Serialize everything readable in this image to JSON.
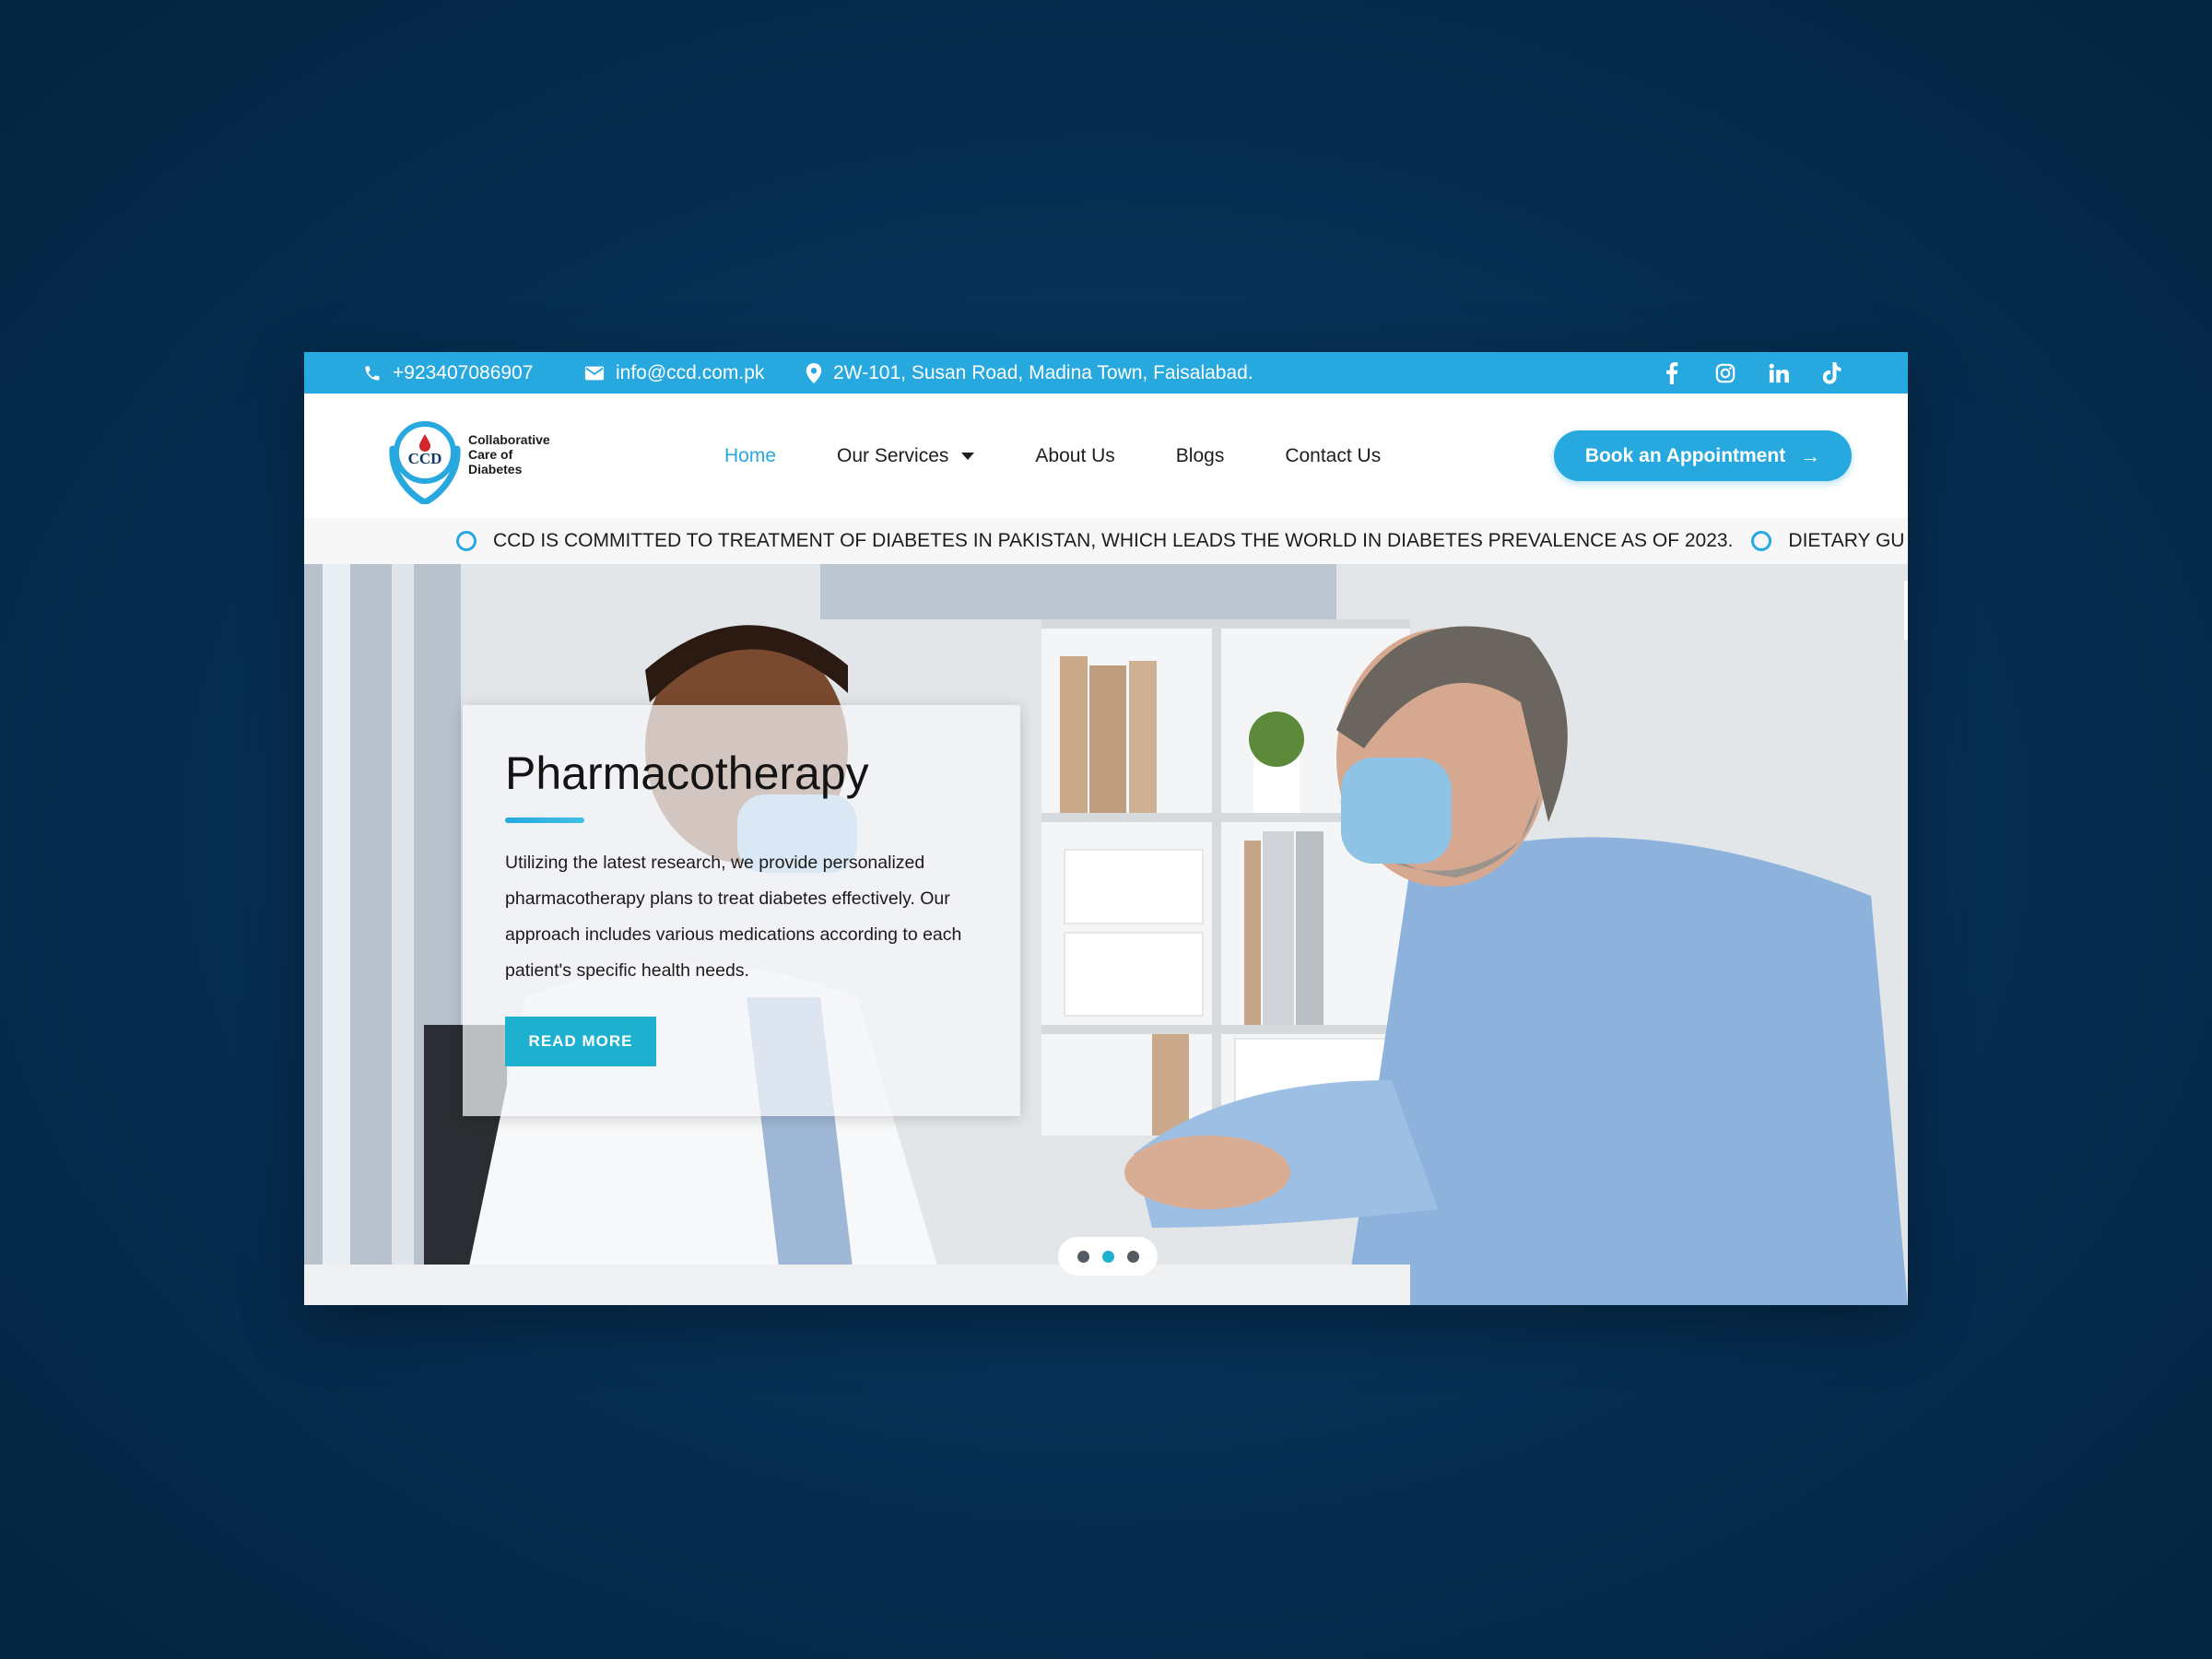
{
  "topbar": {
    "phone": "+923407086907",
    "email": "info@ccd.com.pk",
    "address": "2W-101, Susan Road, Madina Town, Faisalabad.",
    "icons": [
      "phone-icon",
      "mail-icon",
      "location-pin-icon"
    ],
    "social": [
      "facebook-icon",
      "instagram-icon",
      "linkedin-icon",
      "tiktok-icon"
    ],
    "bg_color": "#27a8df"
  },
  "logo": {
    "mark": "CCD",
    "line1": "Collaborative",
    "line2": "Care of",
    "line3": "Diabetes"
  },
  "nav": {
    "items": [
      {
        "label": "Home",
        "active": true
      },
      {
        "label": "Our Services",
        "has_dropdown": true
      },
      {
        "label": "About Us"
      },
      {
        "label": "Blogs"
      },
      {
        "label": "Contact Us"
      }
    ],
    "active_color": "#27a8df"
  },
  "cta": {
    "label": "Book an Appointment",
    "icon": "arrow-right-icon"
  },
  "ticker": {
    "items": [
      "CCD IS COMMITTED TO TREATMENT OF DIABETES IN PAKISTAN, WHICH LEADS THE WORLD IN DIABETES PREVALENCE AS OF 2023.",
      "DIETARY GU"
    ]
  },
  "hero": {
    "title": "Pharmacotherapy",
    "body": "Utilizing the latest research, we provide personalized pharmacotherapy plans to treat diabetes effectively. Our approach includes various medications according to each patient's specific health needs.",
    "button": "READ MORE",
    "button_color": "#1eb0cf",
    "slides": 3,
    "active_slide": 2
  }
}
